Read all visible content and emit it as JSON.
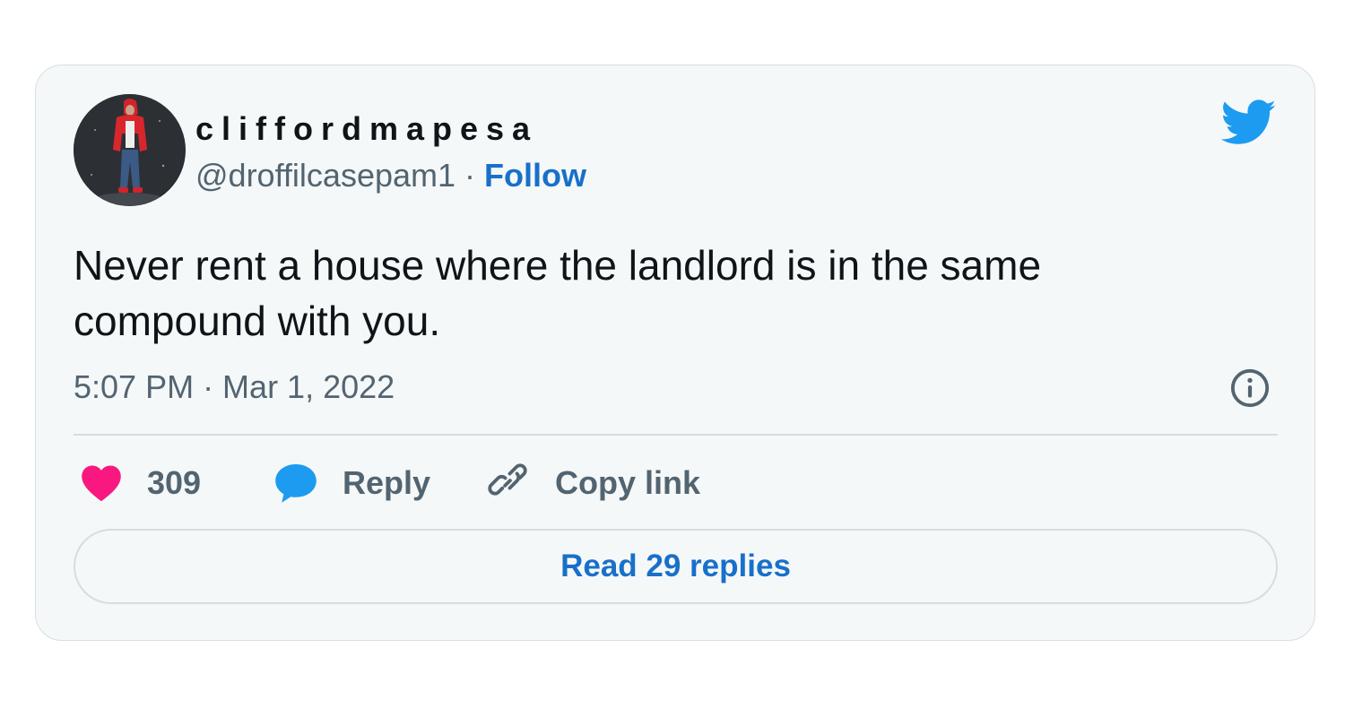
{
  "author": {
    "display_name": "cliffordmapesa",
    "handle": "@droffilcasepam1",
    "separator": " · ",
    "follow_label": "Follow"
  },
  "tweet": {
    "text": "Never rent a house where the landlord is in the same compound with you.",
    "timestamp": "5:07 PM · Mar 1, 2022"
  },
  "actions": {
    "like_count": "309",
    "reply_label": "Reply",
    "copy_link_label": "Copy link"
  },
  "footer": {
    "read_replies_label": "Read 29 replies"
  },
  "icons": {
    "brand": "twitter-bird-icon",
    "info": "info-icon",
    "like": "heart-icon",
    "reply": "speech-bubble-icon",
    "copy": "link-icon"
  },
  "colors": {
    "brand_blue": "#1d9bf0",
    "link_blue": "#1870c9",
    "like_pink": "#f91880",
    "text_primary": "#0f1419",
    "text_secondary": "#536471",
    "card_bg": "#f5f8f8"
  }
}
